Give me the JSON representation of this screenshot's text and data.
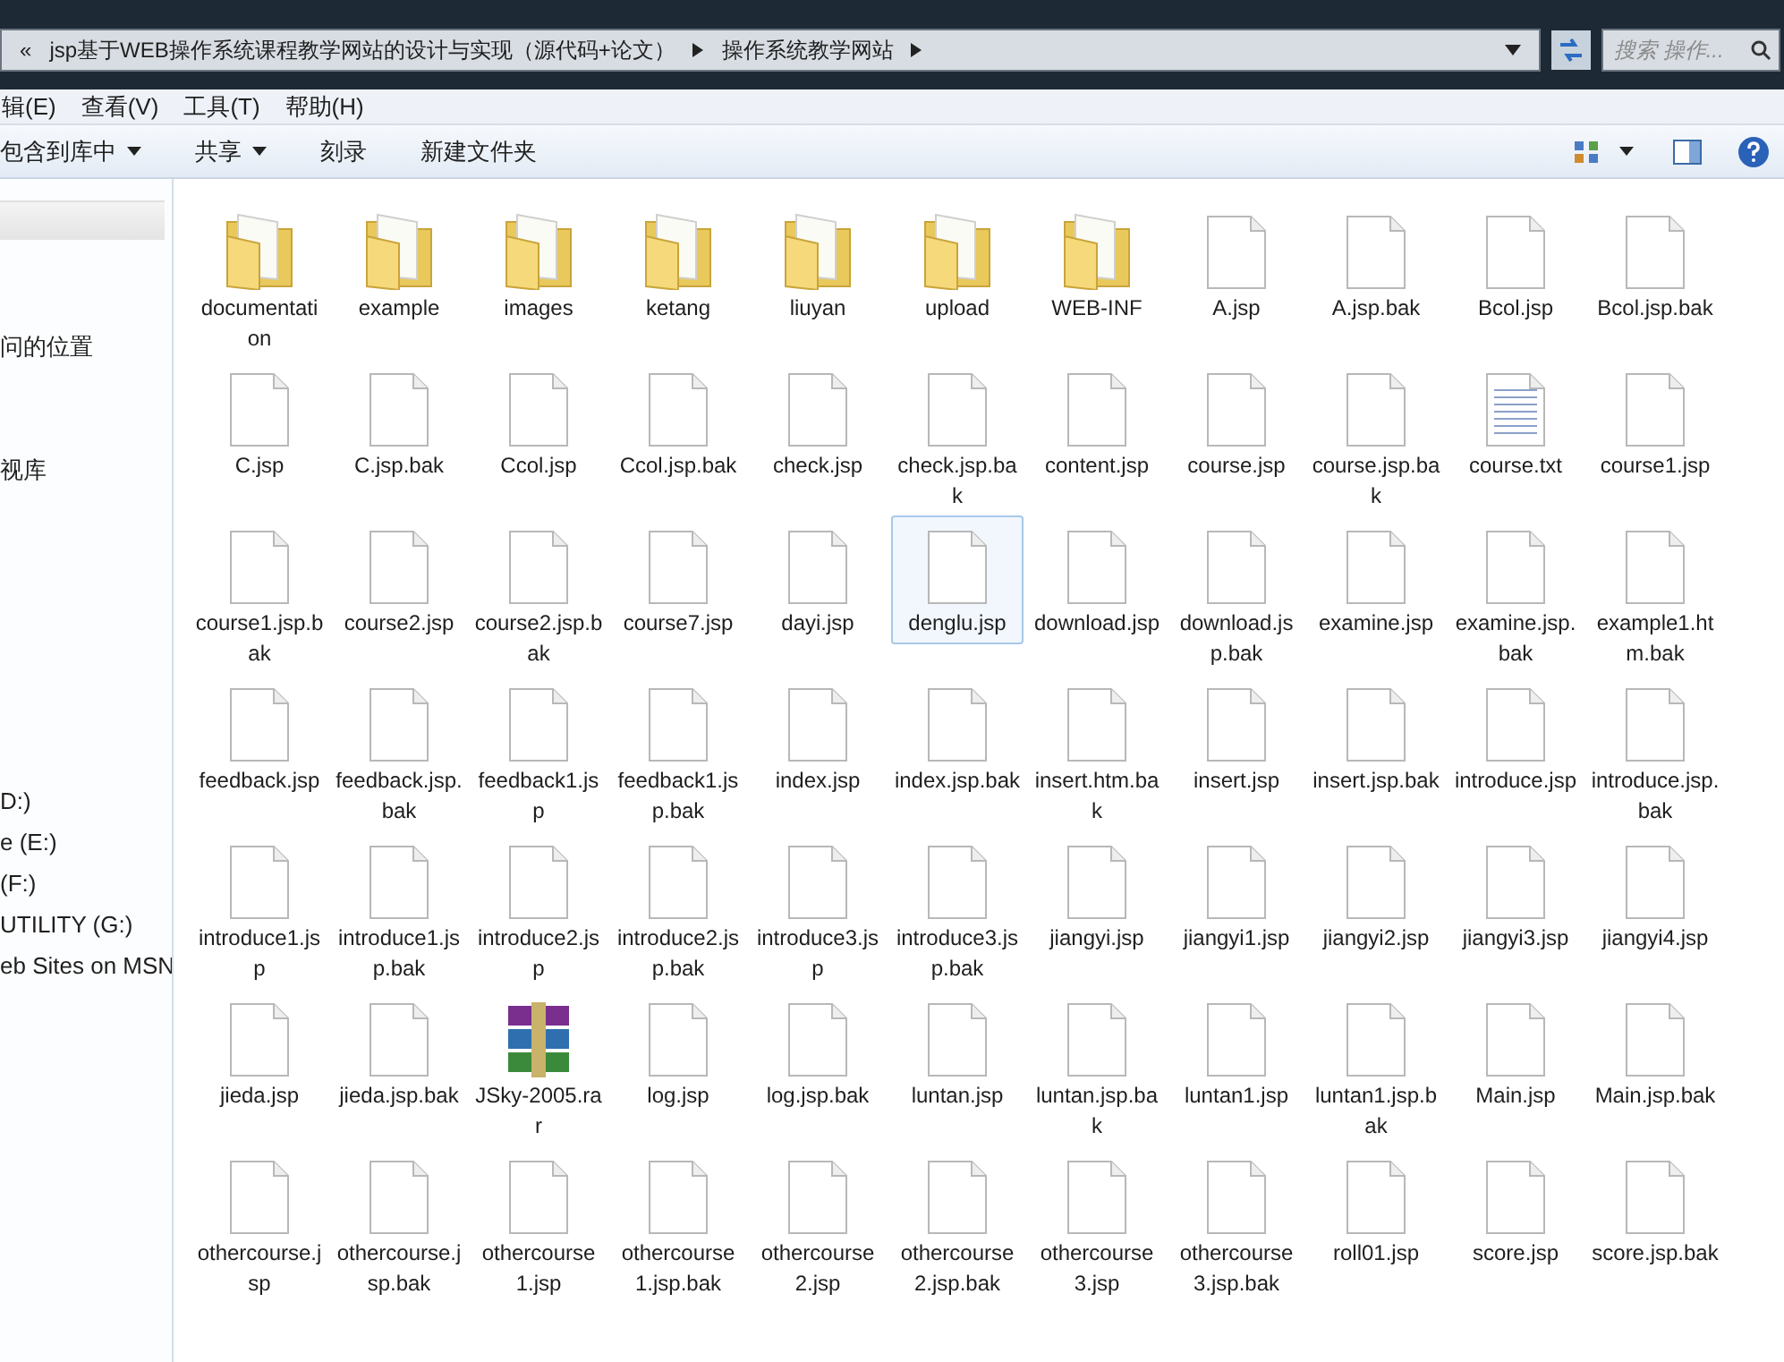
{
  "address_bar": {
    "overflow": "«",
    "crumbs": [
      "jsp基于WEB操作系统课程教学网站的设计与实现（源代码+论文）",
      "操作系统教学网站"
    ],
    "search_placeholder": "搜索 操作..."
  },
  "menu": [
    "辑(E)",
    "查看(V)",
    "工具(T)",
    "帮助(H)"
  ],
  "toolbar": [
    {
      "label": "包含到库中",
      "dropdown": true
    },
    {
      "label": "共享",
      "dropdown": true
    },
    {
      "label": "刻录",
      "dropdown": false
    },
    {
      "label": "新建文件夹",
      "dropdown": false
    }
  ],
  "sidebar": {
    "groups": [
      [
        "问的位置"
      ],
      [
        "视库"
      ],
      [
        "D:)",
        "e (E:)",
        "(F:)",
        "UTILITY (G:)",
        "eb Sites on MSN"
      ]
    ]
  },
  "files": [
    {
      "name": "documentation",
      "kind": "folder",
      "selected": false
    },
    {
      "name": "example",
      "kind": "folder",
      "selected": false
    },
    {
      "name": "images",
      "kind": "folder",
      "selected": false
    },
    {
      "name": "ketang",
      "kind": "folder",
      "selected": false
    },
    {
      "name": "liuyan",
      "kind": "folder",
      "selected": false
    },
    {
      "name": "upload",
      "kind": "folder",
      "selected": false
    },
    {
      "name": "WEB-INF",
      "kind": "folder",
      "selected": false
    },
    {
      "name": "A.jsp",
      "kind": "file",
      "selected": false
    },
    {
      "name": "A.jsp.bak",
      "kind": "file",
      "selected": false
    },
    {
      "name": "Bcol.jsp",
      "kind": "file",
      "selected": false
    },
    {
      "name": "Bcol.jsp.bak",
      "kind": "file",
      "selected": false
    },
    {
      "name": "C.jsp",
      "kind": "file",
      "selected": false
    },
    {
      "name": "C.jsp.bak",
      "kind": "file",
      "selected": false
    },
    {
      "name": "Ccol.jsp",
      "kind": "file",
      "selected": false
    },
    {
      "name": "Ccol.jsp.bak",
      "kind": "file",
      "selected": false
    },
    {
      "name": "check.jsp",
      "kind": "file",
      "selected": false
    },
    {
      "name": "check.jsp.bak",
      "kind": "file",
      "selected": false
    },
    {
      "name": "content.jsp",
      "kind": "file",
      "selected": false
    },
    {
      "name": "course.jsp",
      "kind": "file",
      "selected": false
    },
    {
      "name": "course.jsp.bak",
      "kind": "file",
      "selected": false
    },
    {
      "name": "course.txt",
      "kind": "text",
      "selected": false
    },
    {
      "name": "course1.jsp",
      "kind": "file",
      "selected": false
    },
    {
      "name": "course1.jsp.bak",
      "kind": "file",
      "selected": false
    },
    {
      "name": "course2.jsp",
      "kind": "file",
      "selected": false
    },
    {
      "name": "course2.jsp.bak",
      "kind": "file",
      "selected": false
    },
    {
      "name": "course7.jsp",
      "kind": "file",
      "selected": false
    },
    {
      "name": "dayi.jsp",
      "kind": "file",
      "selected": false
    },
    {
      "name": "denglu.jsp",
      "kind": "file",
      "selected": true
    },
    {
      "name": "download.jsp",
      "kind": "file",
      "selected": false
    },
    {
      "name": "download.jsp.bak",
      "kind": "file",
      "selected": false
    },
    {
      "name": "examine.jsp",
      "kind": "file",
      "selected": false
    },
    {
      "name": "examine.jsp.bak",
      "kind": "file",
      "selected": false
    },
    {
      "name": "example1.htm.bak",
      "kind": "file",
      "selected": false
    },
    {
      "name": "feedback.jsp",
      "kind": "file",
      "selected": false
    },
    {
      "name": "feedback.jsp.bak",
      "kind": "file",
      "selected": false
    },
    {
      "name": "feedback1.jsp",
      "kind": "file",
      "selected": false
    },
    {
      "name": "feedback1.jsp.bak",
      "kind": "file",
      "selected": false
    },
    {
      "name": "index.jsp",
      "kind": "file",
      "selected": false
    },
    {
      "name": "index.jsp.bak",
      "kind": "file",
      "selected": false
    },
    {
      "name": "insert.htm.bak",
      "kind": "file",
      "selected": false
    },
    {
      "name": "insert.jsp",
      "kind": "file",
      "selected": false
    },
    {
      "name": "insert.jsp.bak",
      "kind": "file",
      "selected": false
    },
    {
      "name": "introduce.jsp",
      "kind": "file",
      "selected": false
    },
    {
      "name": "introduce.jsp.bak",
      "kind": "file",
      "selected": false
    },
    {
      "name": "introduce1.jsp",
      "kind": "file",
      "selected": false
    },
    {
      "name": "introduce1.jsp.bak",
      "kind": "file",
      "selected": false
    },
    {
      "name": "introduce2.jsp",
      "kind": "file",
      "selected": false
    },
    {
      "name": "introduce2.jsp.bak",
      "kind": "file",
      "selected": false
    },
    {
      "name": "introduce3.jsp",
      "kind": "file",
      "selected": false
    },
    {
      "name": "introduce3.jsp.bak",
      "kind": "file",
      "selected": false
    },
    {
      "name": "jiangyi.jsp",
      "kind": "file",
      "selected": false
    },
    {
      "name": "jiangyi1.jsp",
      "kind": "file",
      "selected": false
    },
    {
      "name": "jiangyi2.jsp",
      "kind": "file",
      "selected": false
    },
    {
      "name": "jiangyi3.jsp",
      "kind": "file",
      "selected": false
    },
    {
      "name": "jiangyi4.jsp",
      "kind": "file",
      "selected": false
    },
    {
      "name": "jieda.jsp",
      "kind": "file",
      "selected": false
    },
    {
      "name": "jieda.jsp.bak",
      "kind": "file",
      "selected": false
    },
    {
      "name": "JSky-2005.rar",
      "kind": "archive",
      "selected": false
    },
    {
      "name": "log.jsp",
      "kind": "file",
      "selected": false
    },
    {
      "name": "log.jsp.bak",
      "kind": "file",
      "selected": false
    },
    {
      "name": "luntan.jsp",
      "kind": "file",
      "selected": false
    },
    {
      "name": "luntan.jsp.bak",
      "kind": "file",
      "selected": false
    },
    {
      "name": "luntan1.jsp",
      "kind": "file",
      "selected": false
    },
    {
      "name": "luntan1.jsp.bak",
      "kind": "file",
      "selected": false
    },
    {
      "name": "Main.jsp",
      "kind": "file",
      "selected": false
    },
    {
      "name": "Main.jsp.bak",
      "kind": "file",
      "selected": false
    },
    {
      "name": "othercourse.jsp",
      "kind": "file",
      "selected": false
    },
    {
      "name": "othercourse.jsp.bak",
      "kind": "file",
      "selected": false
    },
    {
      "name": "othercourse1.jsp",
      "kind": "file",
      "selected": false
    },
    {
      "name": "othercourse1.jsp.bak",
      "kind": "file",
      "selected": false
    },
    {
      "name": "othercourse2.jsp",
      "kind": "file",
      "selected": false
    },
    {
      "name": "othercourse2.jsp.bak",
      "kind": "file",
      "selected": false
    },
    {
      "name": "othercourse3.jsp",
      "kind": "file",
      "selected": false
    },
    {
      "name": "othercourse3.jsp.bak",
      "kind": "file",
      "selected": false
    },
    {
      "name": "roll01.jsp",
      "kind": "file",
      "selected": false
    },
    {
      "name": "score.jsp",
      "kind": "file",
      "selected": false
    },
    {
      "name": "score.jsp.bak",
      "kind": "file",
      "selected": false
    }
  ]
}
